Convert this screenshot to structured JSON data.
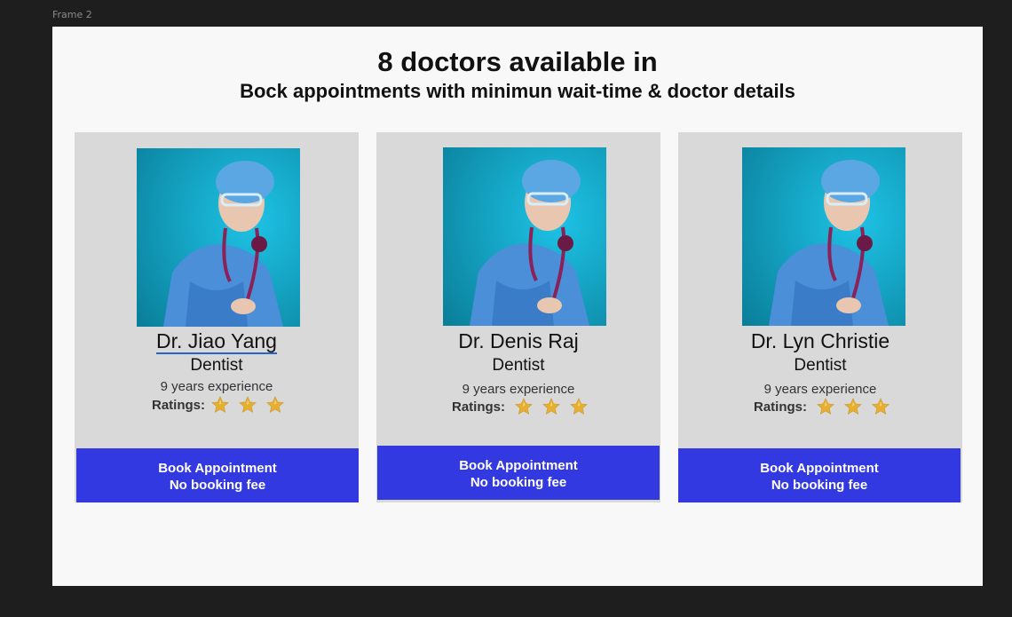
{
  "frame_label": "Frame 2",
  "header": {
    "title": "8 doctors available in",
    "subtitle": "Bock appointments with minimun wait-time & doctor details"
  },
  "doctors": [
    {
      "name": "Dr. Jiao Yang",
      "specialty": "Dentist",
      "experience": "9 years experience",
      "ratings_label": "Ratings:",
      "rating": 3,
      "book_label": "Book Appointment",
      "fee_label": "No booking fee"
    },
    {
      "name": "Dr. Denis Raj",
      "specialty": "Dentist",
      "experience": "9 years experience",
      "ratings_label": "Ratings:",
      "rating": 3,
      "book_label": "Book Appointment",
      "fee_label": "No booking fee"
    },
    {
      "name": "Dr. Lyn Christie",
      "specialty": "Dentist",
      "experience": "9 years experience",
      "ratings_label": "Ratings:",
      "rating": 3,
      "book_label": "Book Appointment",
      "fee_label": "No booking fee"
    }
  ],
  "colors": {
    "button": "#3339e0",
    "card": "#d9d9d9",
    "star": "#e6b02e"
  }
}
